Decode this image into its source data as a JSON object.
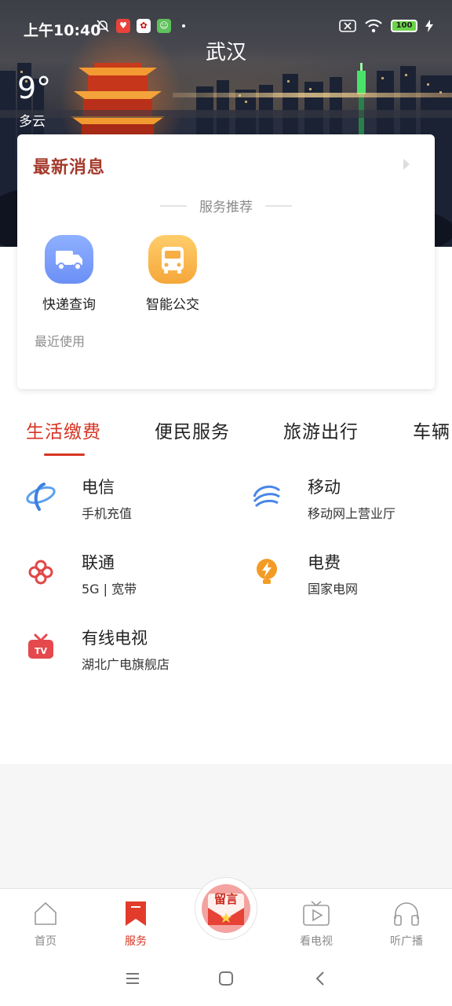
{
  "status": {
    "time": "上午10:40",
    "battery": "100"
  },
  "header": {
    "city": "武汉",
    "temperature": "9°",
    "weather": "多云"
  },
  "card": {
    "news_title": "最新消息",
    "recommend_label": "服务推荐",
    "services": [
      {
        "name": "快递查询",
        "icon": "delivery-truck-icon"
      },
      {
        "name": "智能公交",
        "icon": "bus-icon"
      }
    ],
    "recent_label": "最近使用"
  },
  "tabs": [
    {
      "label": "生活缴费",
      "active": true
    },
    {
      "label": "便民服务",
      "active": false
    },
    {
      "label": "旅游出行",
      "active": false
    },
    {
      "label": "车辆",
      "active": false
    }
  ],
  "items": [
    {
      "title": "电信",
      "subtitle": "手机充值",
      "icon": "telecom-icon"
    },
    {
      "title": "移动",
      "subtitle": "移动网上营业厅",
      "icon": "mobile-icon"
    },
    {
      "title": "联通",
      "subtitle": "5G | 宽带",
      "icon": "unicom-icon"
    },
    {
      "title": "电费",
      "subtitle": "国家电网",
      "icon": "electricity-icon"
    },
    {
      "title": "有线电视",
      "subtitle": "湖北广电旗舰店",
      "icon": "tv-icon"
    }
  ],
  "bottom_nav": [
    {
      "label": "首页",
      "icon": "home-icon",
      "active": false
    },
    {
      "label": "服务",
      "icon": "service-bookmark-icon",
      "active": true
    },
    {
      "label": "留言",
      "icon": "message-envelope-icon",
      "active": false
    },
    {
      "label": "看电视",
      "icon": "tv-play-icon",
      "active": false
    },
    {
      "label": "听广播",
      "icon": "headphones-icon",
      "active": false
    }
  ],
  "colors": {
    "accent": "#d73524",
    "news_title": "#a53a2c"
  }
}
